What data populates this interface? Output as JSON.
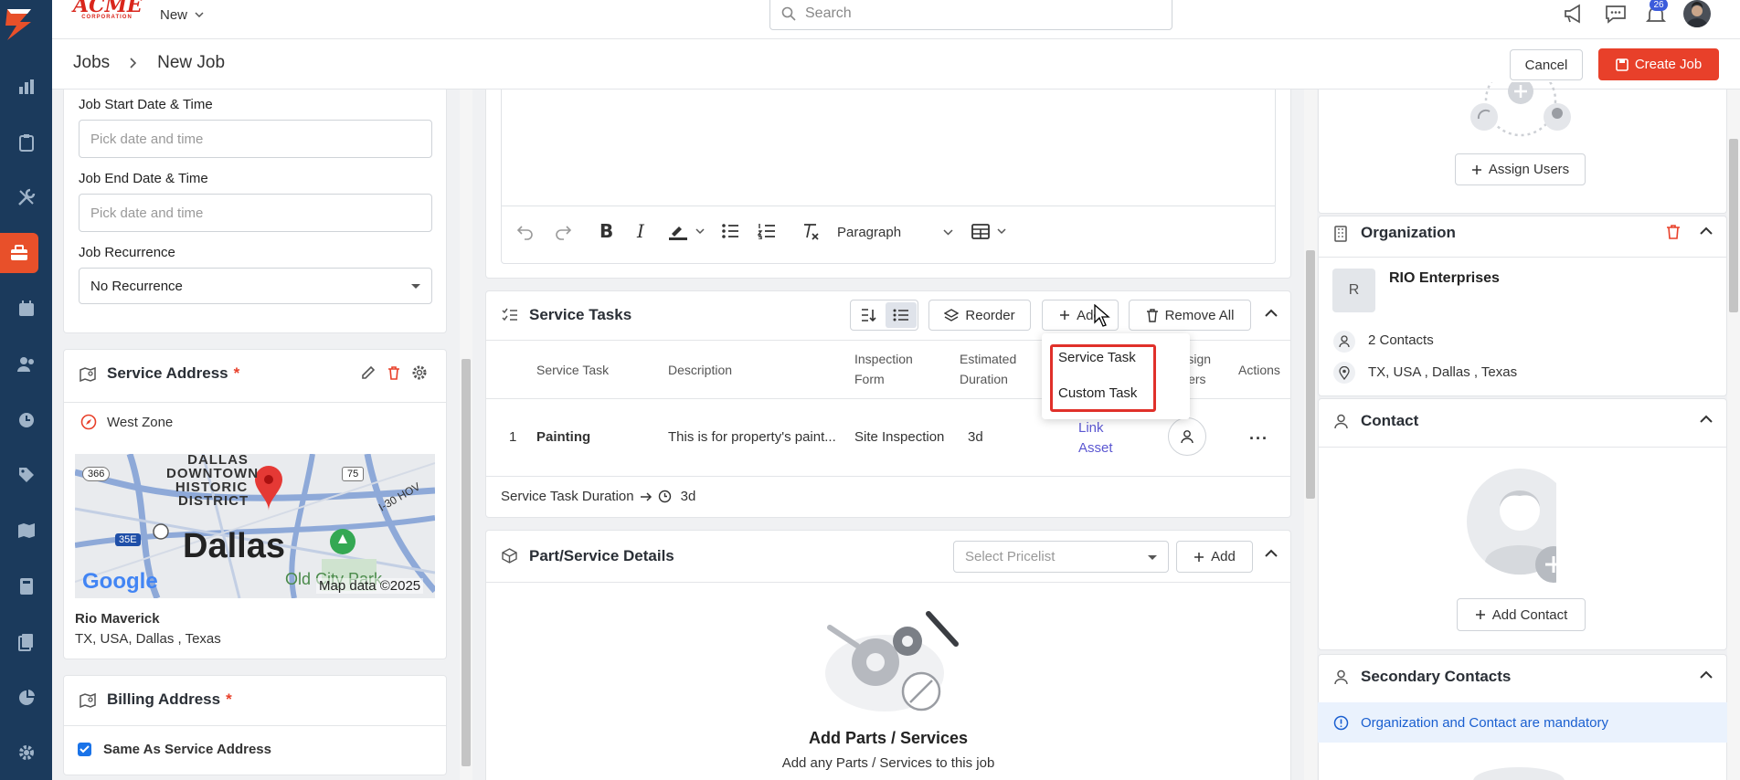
{
  "brand": {
    "logo_text": "ACME",
    "logo_sub": "CORPORATION",
    "accent": "#e8402a",
    "sidebar_color": "#1b3a5c"
  },
  "topbar": {
    "new_label": "New",
    "search_placeholder": "Search",
    "notification_count": "26"
  },
  "breadcrumb": {
    "parent": "Jobs",
    "current": "New Job"
  },
  "header_actions": {
    "cancel": "Cancel",
    "create": "Create Job"
  },
  "left": {
    "start_label": "Job Start Date & Time",
    "start_placeholder": "Pick date and time",
    "end_label": "Job End Date & Time",
    "end_placeholder": "Pick date and time",
    "recurrence_label": "Job Recurrence",
    "recurrence_value": "No Recurrence",
    "service_address_title": "Service Address",
    "required_mark": "*",
    "zone": "West Zone",
    "map": {
      "city": "Dallas",
      "district1": "DALLAS",
      "district2": "DOWNTOWN",
      "district3": "HISTORIC",
      "district4": "DISTRICT",
      "road366": "366",
      "road75": "75",
      "road35": "35E",
      "road30": "I-30 HOV",
      "park": "Old City Park",
      "google": "Google",
      "attribution": "Map data ©2025"
    },
    "addr_name": "Rio Maverick",
    "addr_line": "TX, USA, Dallas , Texas",
    "billing_title": "Billing Address",
    "same_as": "Same As Service Address"
  },
  "editor": {
    "paragraph": "Paragraph"
  },
  "tasks": {
    "title": "Service Tasks",
    "reorder": "Reorder",
    "add": "Add",
    "remove_all": "Remove All",
    "columns": {
      "task": "Service Task",
      "desc": "Description",
      "form1": "Inspection",
      "form2": "Form",
      "dur1": "Estimated",
      "dur2": "Duration",
      "assign1": "Assign",
      "assign2": "Users",
      "actions": "Actions"
    },
    "rows": [
      {
        "num": "1",
        "task": "Painting",
        "desc": "This is for property's paint...",
        "form": "Site Inspection",
        "duration": "3d",
        "link1": "Link",
        "link2": "Asset"
      }
    ],
    "duration_label": "Service Task Duration",
    "duration_value": "3d",
    "dropdown": [
      "Service Task",
      "Custom Task"
    ]
  },
  "parts": {
    "title": "Part/Service Details",
    "pricelist_placeholder": "Select Pricelist",
    "add": "Add",
    "empty_title": "Add Parts / Services",
    "empty_sub": "Add any Parts / Services to this job"
  },
  "right": {
    "assign_users": "Assign Users",
    "org_title": "Organization",
    "org_initial": "R",
    "org_name": "RIO Enterprises",
    "contacts": "2 Contacts",
    "org_address": "TX, USA , Dallas , Texas",
    "contact_title": "Contact",
    "add_contact": "Add Contact",
    "secondary_title": "Secondary Contacts",
    "mandatory_note": "Organization and Contact are mandatory"
  }
}
